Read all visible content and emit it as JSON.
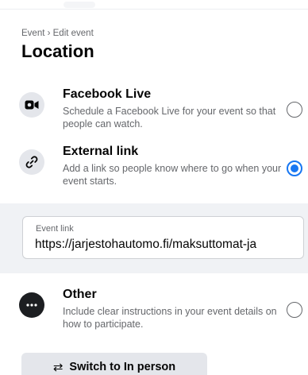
{
  "breadcrumb": "Event › Edit event",
  "title": "Location",
  "options": [
    {
      "title": "Facebook Live",
      "description": "Schedule a Facebook Live for your event so that people can watch.",
      "icon": "video-camera-icon",
      "selected": false
    },
    {
      "title": "External link",
      "description": "Add a link so people know where to go when your event starts.",
      "icon": "link-icon",
      "selected": true
    },
    {
      "title": "Other",
      "description": "Include clear instructions in your event details on how to participate.",
      "icon": "more-horizontal-icon",
      "selected": false
    }
  ],
  "event_link": {
    "label": "Event link",
    "value": "https://jarjestohautomo.fi/maksuttomat-ja"
  },
  "switch_button": {
    "icon": "swap-arrows-icon",
    "label": "Switch to In person"
  },
  "colors": {
    "accent": "#1877f2",
    "secondary_text": "#65676b",
    "panel_bg": "#f0f2f5",
    "button_bg": "#e4e6eb"
  }
}
